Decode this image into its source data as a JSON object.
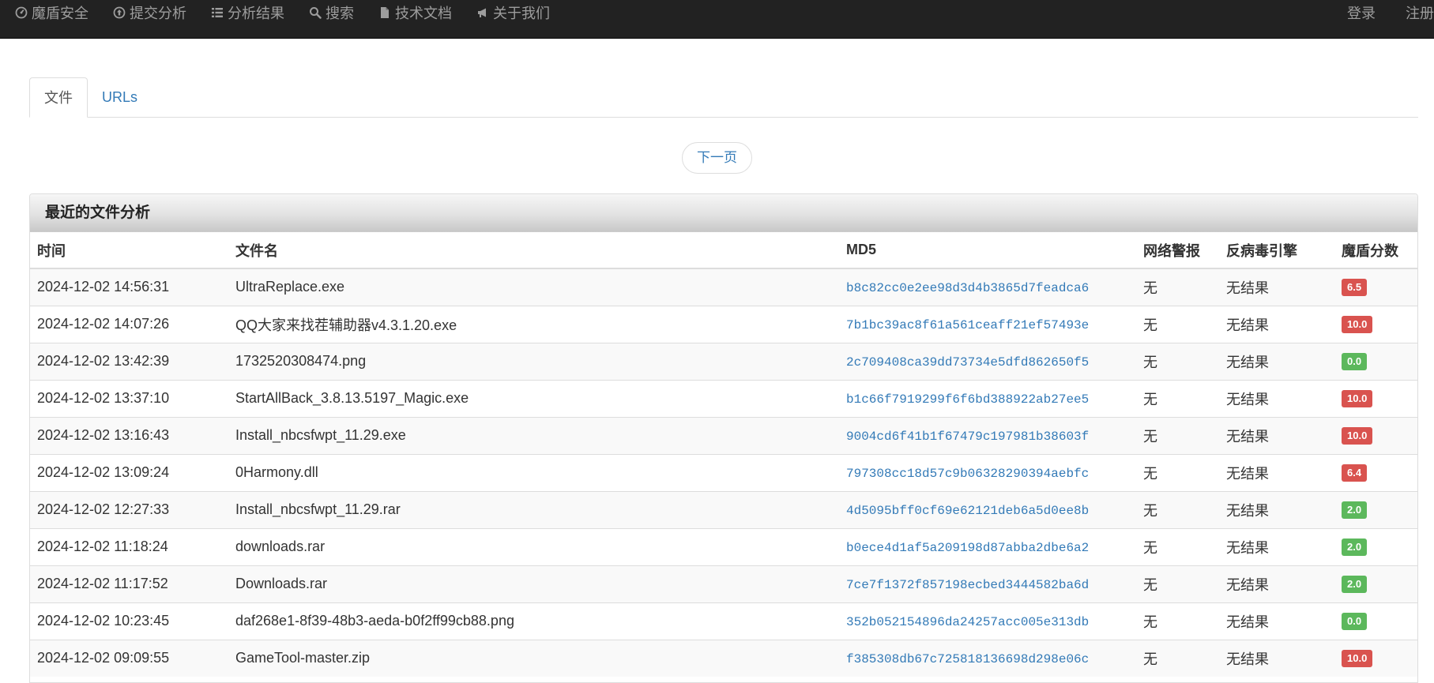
{
  "nav": {
    "brand": "魔盾安全",
    "items": [
      {
        "label": "提交分析",
        "icon": "upload-circle-icon"
      },
      {
        "label": "分析结果",
        "icon": "list-icon"
      },
      {
        "label": "搜索",
        "icon": "search-icon"
      },
      {
        "label": "技术文档",
        "icon": "document-icon"
      },
      {
        "label": "关于我们",
        "icon": "bullhorn-icon"
      }
    ],
    "login": "登录",
    "register": "注册"
  },
  "tabs": [
    {
      "label": "文件",
      "active": true
    },
    {
      "label": "URLs",
      "active": false
    }
  ],
  "pager": {
    "next_label": "下一页"
  },
  "panel": {
    "title": "最近的文件分析",
    "columns": [
      "时间",
      "文件名",
      "MD5",
      "网络警报",
      "反病毒引擎",
      "魔盾分数"
    ],
    "rows": [
      {
        "time": "2024-12-02 14:56:31",
        "filename": "UltraReplace.exe",
        "md5": "b8c82cc0e2ee98d3d4b3865d7feadca6",
        "alerts": "无",
        "av": "无结果",
        "score": "6.5",
        "score_color": "#d9534f"
      },
      {
        "time": "2024-12-02 14:07:26",
        "filename": "QQ大家来找茬辅助器v4.3.1.20.exe",
        "md5": "7b1bc39ac8f61a561ceaff21ef57493e",
        "alerts": "无",
        "av": "无结果",
        "score": "10.0",
        "score_color": "#d9534f"
      },
      {
        "time": "2024-12-02 13:42:39",
        "filename": "1732520308474.png",
        "md5": "2c709408ca39dd73734e5dfd862650f5",
        "alerts": "无",
        "av": "无结果",
        "score": "0.0",
        "score_color": "#5cb85c"
      },
      {
        "time": "2024-12-02 13:37:10",
        "filename": "StartAllBack_3.8.13.5197_Magic.exe",
        "md5": "b1c66f7919299f6f6bd388922ab27ee5",
        "alerts": "无",
        "av": "无结果",
        "score": "10.0",
        "score_color": "#d9534f"
      },
      {
        "time": "2024-12-02 13:16:43",
        "filename": "Install_nbcsfwpt_11.29.exe",
        "md5": "9004cd6f41b1f67479c197981b38603f",
        "alerts": "无",
        "av": "无结果",
        "score": "10.0",
        "score_color": "#d9534f"
      },
      {
        "time": "2024-12-02 13:09:24",
        "filename": "0Harmony.dll",
        "md5": "797308cc18d57c9b06328290394aebfc",
        "alerts": "无",
        "av": "无结果",
        "score": "6.4",
        "score_color": "#d9534f"
      },
      {
        "time": "2024-12-02 12:27:33",
        "filename": "Install_nbcsfwpt_11.29.rar",
        "md5": "4d5095bff0cf69e62121deb6a5d0ee8b",
        "alerts": "无",
        "av": "无结果",
        "score": "2.0",
        "score_color": "#5cb85c"
      },
      {
        "time": "2024-12-02 11:18:24",
        "filename": "downloads.rar",
        "md5": "b0ece4d1af5a209198d87abba2dbe6a2",
        "alerts": "无",
        "av": "无结果",
        "score": "2.0",
        "score_color": "#5cb85c"
      },
      {
        "time": "2024-12-02 11:17:52",
        "filename": "Downloads.rar",
        "md5": "7ce7f1372f857198ecbed3444582ba6d",
        "alerts": "无",
        "av": "无结果",
        "score": "2.0",
        "score_color": "#5cb85c"
      },
      {
        "time": "2024-12-02 10:23:45",
        "filename": "daf268e1-8f39-48b3-aeda-b0f2ff99cb88.png",
        "md5": "352b052154896da24257acc005e313db",
        "alerts": "无",
        "av": "无结果",
        "score": "0.0",
        "score_color": "#5cb85c"
      },
      {
        "time": "2024-12-02 09:09:55",
        "filename": "GameTool-master.zip",
        "md5": "f385308db67c725818136698d298e06c",
        "alerts": "无",
        "av": "无结果",
        "score": "10.0",
        "score_color": "#d9534f"
      }
    ]
  }
}
